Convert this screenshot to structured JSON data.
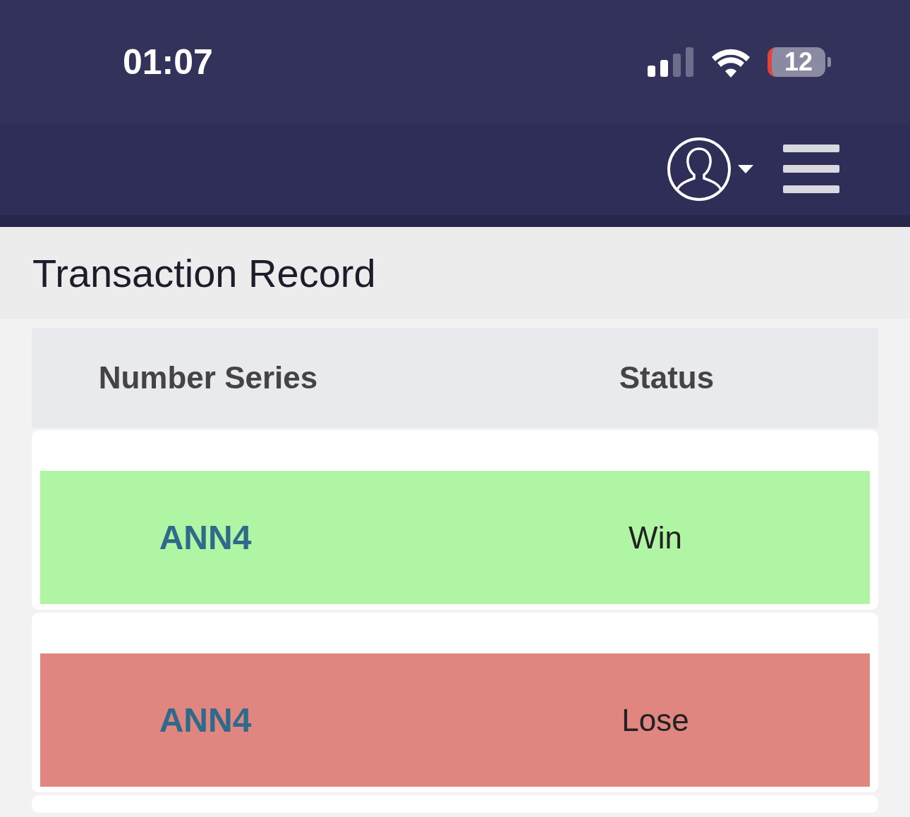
{
  "status_bar": {
    "time": "01:07",
    "battery": "12"
  },
  "page": {
    "title": "Transaction Record"
  },
  "table": {
    "columns": [
      "Number Series",
      "Status"
    ],
    "rows": [
      {
        "series": "ANN4",
        "status": "Win",
        "kind": "win"
      },
      {
        "series": "ANN4",
        "status": "Lose",
        "kind": "lose"
      }
    ]
  }
}
